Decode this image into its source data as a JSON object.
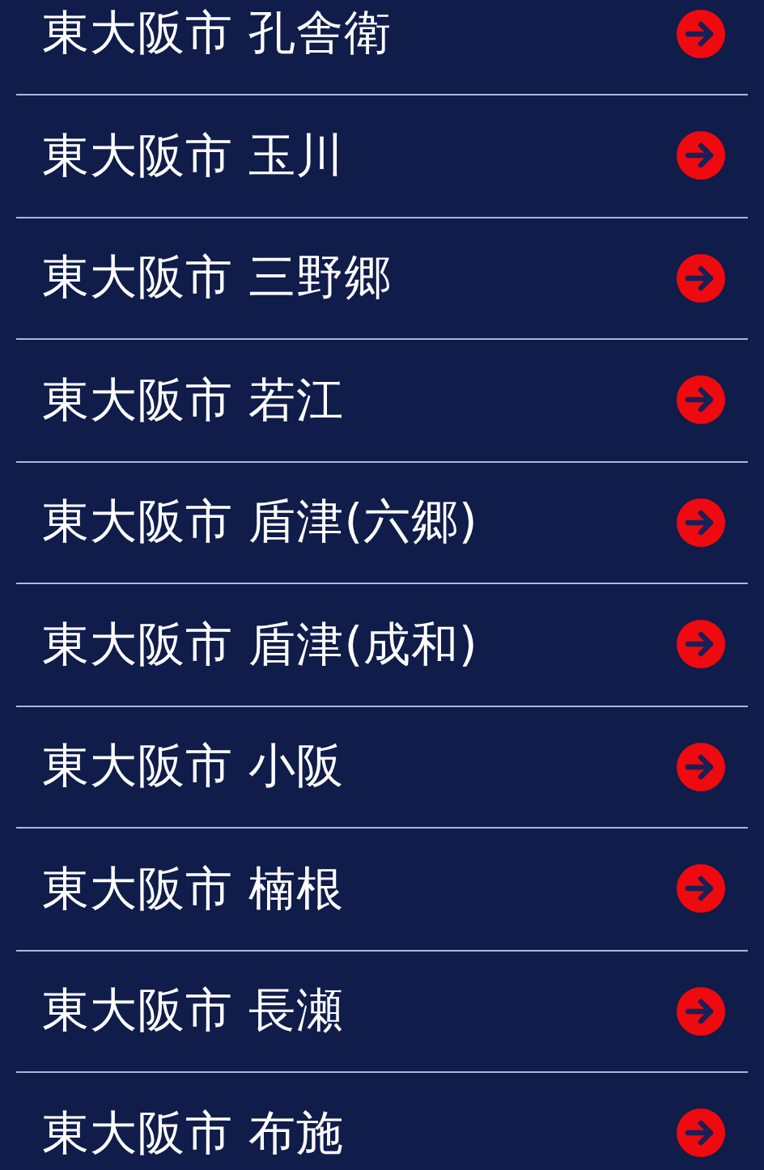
{
  "items": [
    {
      "label": "東大阪市 孔舎衛"
    },
    {
      "label": "東大阪市 玉川"
    },
    {
      "label": "東大阪市 三野郷"
    },
    {
      "label": "東大阪市 若江"
    },
    {
      "label": "東大阪市 盾津(六郷)"
    },
    {
      "label": "東大阪市 盾津(成和)"
    },
    {
      "label": "東大阪市 小阪"
    },
    {
      "label": "東大阪市 楠根"
    },
    {
      "label": "東大阪市 長瀬"
    },
    {
      "label": "東大阪市 布施"
    }
  ]
}
